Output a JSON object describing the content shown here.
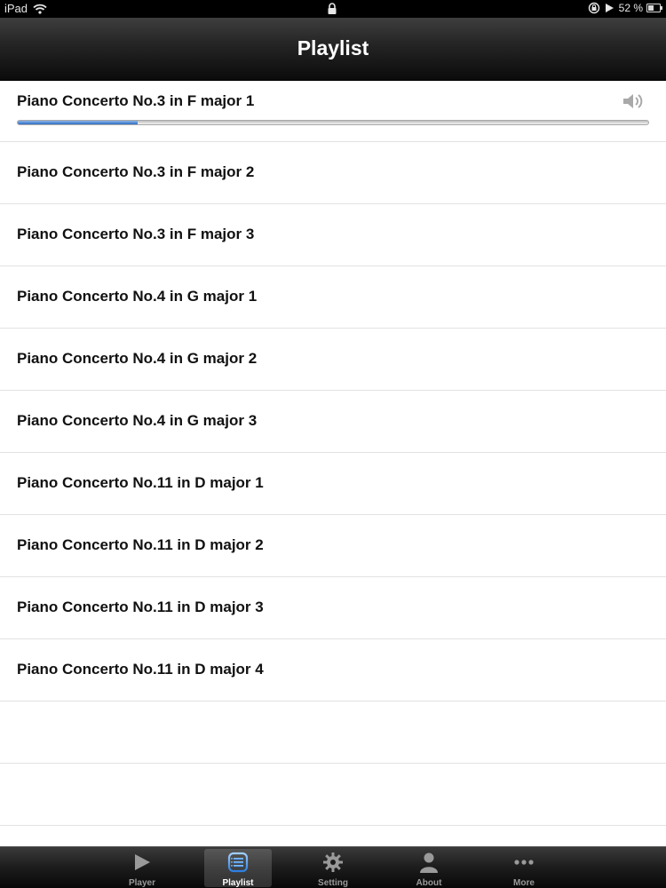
{
  "status_bar": {
    "device": "iPad",
    "battery": "52 %",
    "battery_level": 0.52
  },
  "nav": {
    "title": "Playlist"
  },
  "playlist": {
    "now_playing_progress": 0.19,
    "items": [
      {
        "title": "Piano Concerto No.3 in F major 1"
      },
      {
        "title": "Piano Concerto No.3 in F major 2"
      },
      {
        "title": "Piano Concerto No.3 in F major 3"
      },
      {
        "title": "Piano Concerto No.4 in G major 1"
      },
      {
        "title": "Piano Concerto No.4 in G major 2"
      },
      {
        "title": "Piano Concerto No.4 in G major 3"
      },
      {
        "title": "Piano Concerto No.11 in D major 1"
      },
      {
        "title": "Piano Concerto No.11 in D major 2"
      },
      {
        "title": "Piano Concerto No.11 in D major 3"
      },
      {
        "title": "Piano Concerto No.11 in D major 4"
      }
    ]
  },
  "tabs": [
    {
      "label": "Player",
      "icon": "play-icon"
    },
    {
      "label": "Playlist",
      "icon": "playlist-icon",
      "selected": true
    },
    {
      "label": "Setting",
      "icon": "gear-icon"
    },
    {
      "label": "About",
      "icon": "person-icon"
    },
    {
      "label": "More",
      "icon": "more-icon"
    }
  ],
  "colors": {
    "accent": "#2f6ec6",
    "nav_background": "#1a1a1a",
    "tab_active": "#ffffff",
    "tab_inactive": "#9a9a9a"
  }
}
